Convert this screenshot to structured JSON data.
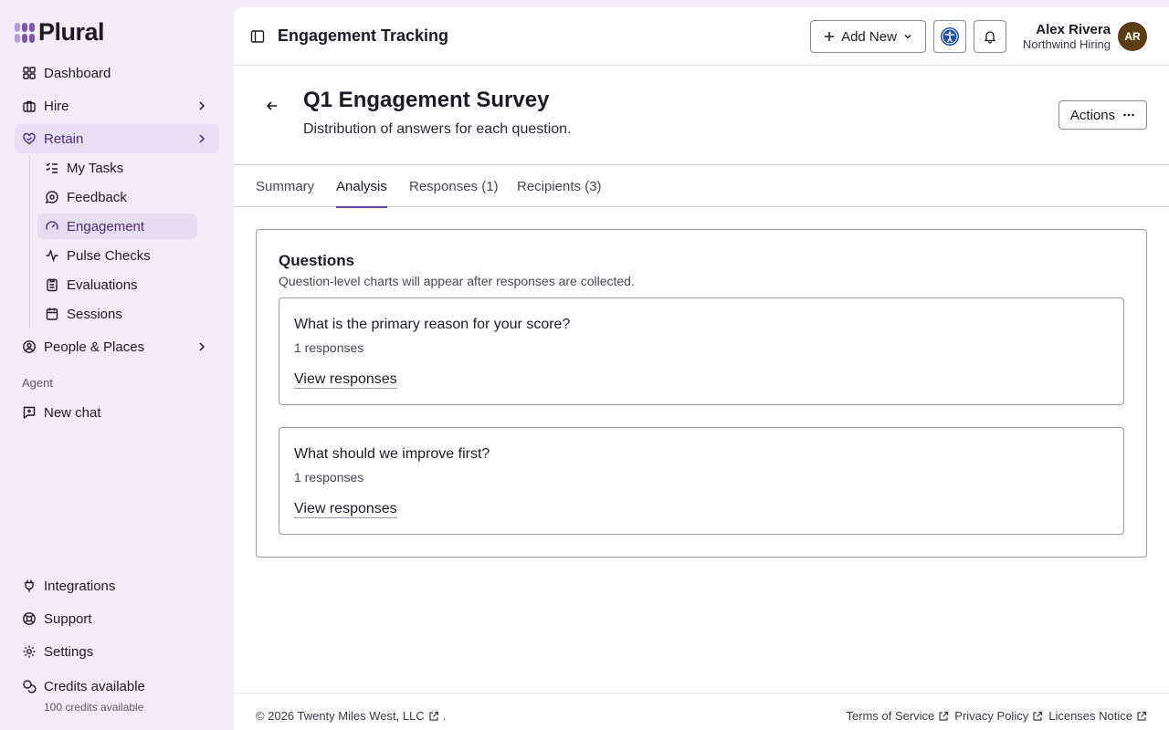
{
  "brand": {
    "name": "Plural"
  },
  "sidebar": {
    "items": [
      {
        "label": "Dashboard"
      },
      {
        "label": "Hire"
      },
      {
        "label": "Retain"
      },
      {
        "label": "People & Places"
      },
      {
        "label": "New chat"
      },
      {
        "label": "Integrations"
      },
      {
        "label": "Support"
      },
      {
        "label": "Settings"
      },
      {
        "label": "Credits available"
      }
    ],
    "retain_items": [
      {
        "label": "My Tasks"
      },
      {
        "label": "Feedback"
      },
      {
        "label": "Engagement"
      },
      {
        "label": "Pulse Checks"
      },
      {
        "label": "Evaluations"
      },
      {
        "label": "Sessions"
      }
    ],
    "section_agent": "Agent",
    "credits_sub": "100 credits available"
  },
  "header": {
    "title": "Engagement Tracking",
    "add_new_label": "Add New",
    "user": {
      "name": "Alex Rivera",
      "org": "Northwind Hiring",
      "initials": "AR"
    }
  },
  "page": {
    "title": "Q1 Engagement Survey",
    "subtitle": "Distribution of answers for each question.",
    "actions_label": "Actions"
  },
  "tabs": [
    {
      "label": "Summary"
    },
    {
      "label": "Analysis"
    },
    {
      "label": "Responses (1)"
    },
    {
      "label": "Recipients (3)"
    }
  ],
  "questions": {
    "heading": "Questions",
    "note": "Question-level charts will appear after responses are collected.",
    "items": [
      {
        "title": "What is the primary reason for your score?",
        "count": "1 responses",
        "link": "View responses"
      },
      {
        "title": "What should we improve first?",
        "count": "1 responses",
        "link": "View responses"
      }
    ]
  },
  "footer": {
    "copyright": "© 2026 Twenty Miles West, LLC",
    "copyright_suffix": ".",
    "links": [
      {
        "label": "Terms of Service"
      },
      {
        "label": "Privacy Policy"
      },
      {
        "label": "Licenses Notice"
      }
    ]
  },
  "colors": {
    "accent": "#6b3fa0",
    "active_bg": "#e7def3",
    "sidebar_bg": "#f1ecf8",
    "avatar_bg": "#5b3d16",
    "accessibility_blue": "#1d4f9c"
  }
}
